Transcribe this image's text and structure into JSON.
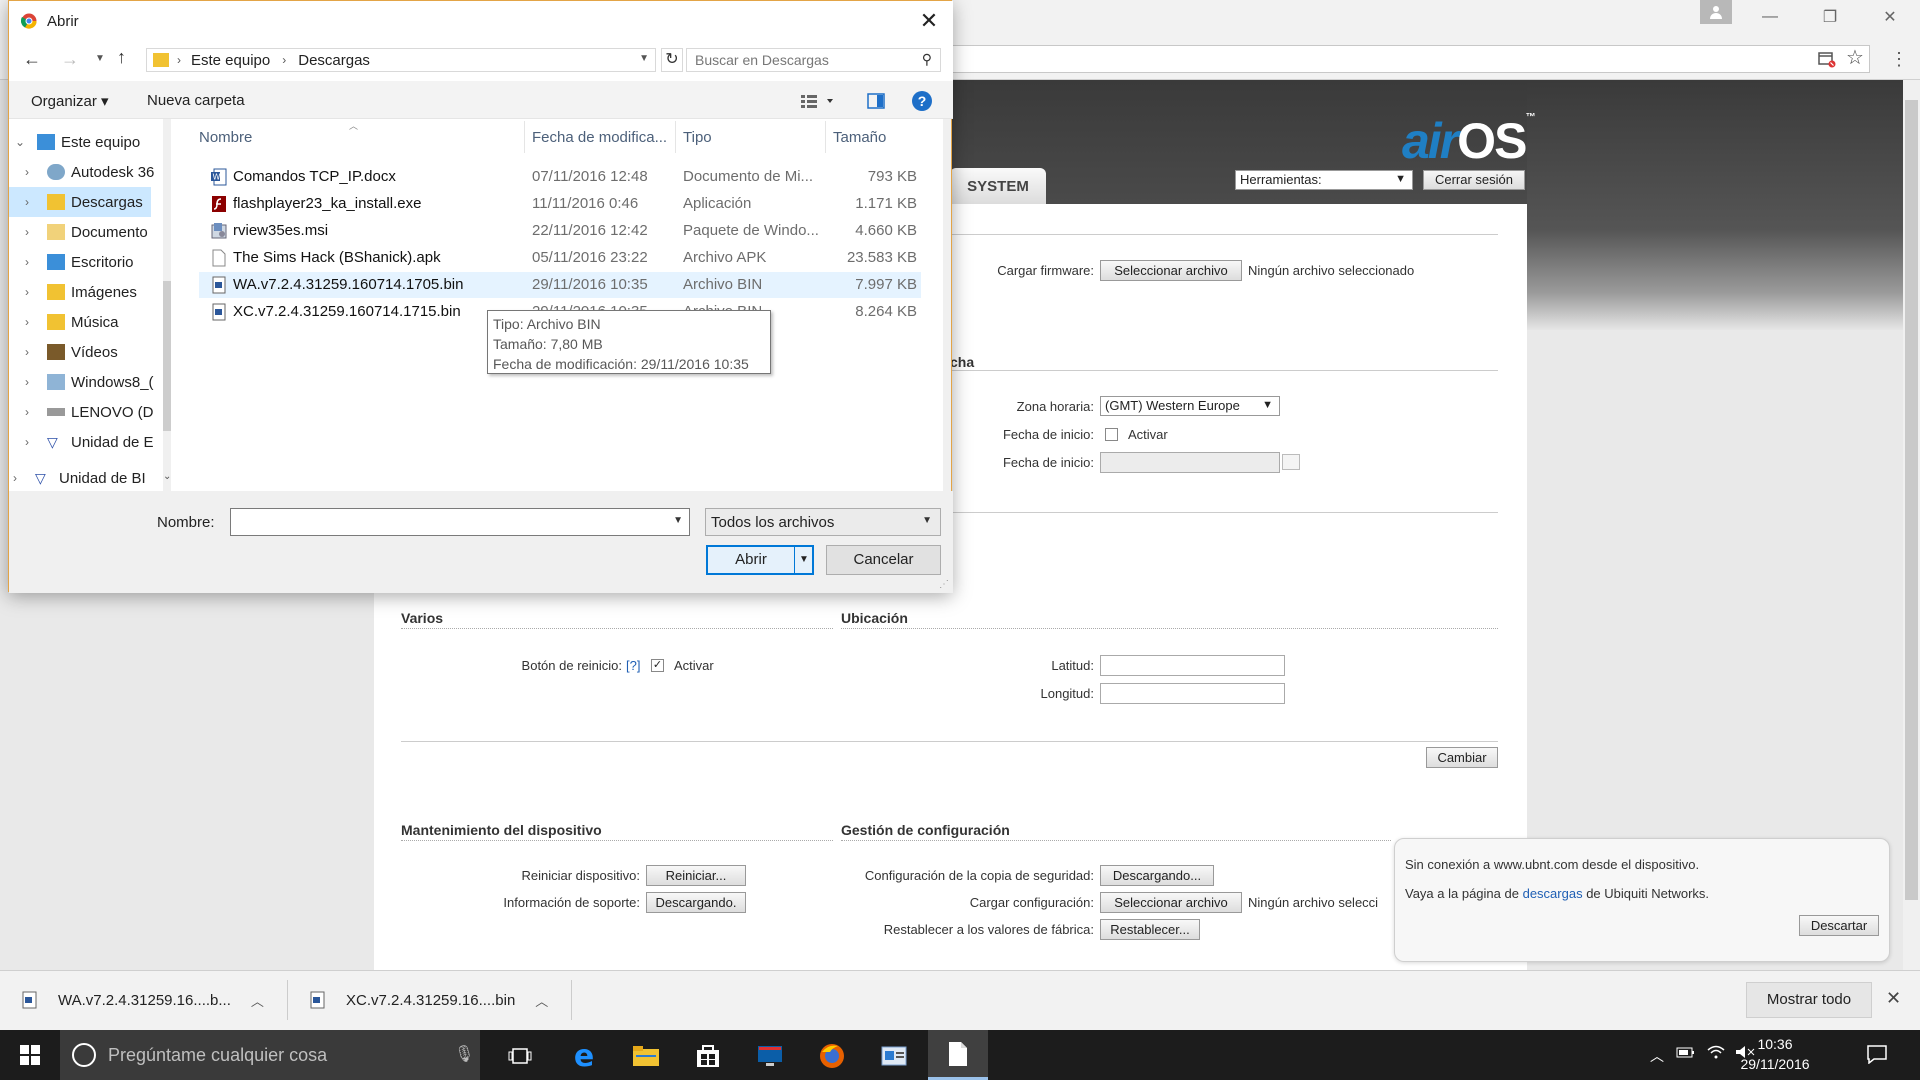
{
  "browser": {
    "user_icon": "person-icon",
    "minimize": "—",
    "restore": "❐",
    "close": "✕"
  },
  "airos": {
    "logo_air": "air",
    "logo_os": "OS",
    "logo_tm": "™",
    "tab_system": "SYSTEM",
    "tools_select": "Herramientas:",
    "logout": "Cerrar sesión",
    "firmware_label": "Cargar firmware:",
    "firmware_button": "Seleccionar archivo",
    "firmware_status": "Ningún archivo seleccionado",
    "date_section_fragment": "cha",
    "timezone_label": "Zona horaria:",
    "timezone_value": "(GMT) Western Europe",
    "start_date_label_1": "Fecha de inicio:",
    "start_date_activate": "Activar",
    "start_date_label_2": "Fecha de inicio:",
    "section_misc": "Varios",
    "section_location": "Ubicación",
    "reset_button_label": "Botón de reinicio:",
    "reset_help": "[?]",
    "reset_activate": "Activar",
    "latitude_label": "Latitud:",
    "longitude_label": "Longitud:",
    "change_button": "Cambiar",
    "section_maintenance": "Mantenimiento del dispositivo",
    "section_config": "Gestión de configuración",
    "reboot_label": "Reiniciar dispositivo:",
    "reboot_button": "Reiniciar...",
    "support_label": "Información de soporte:",
    "support_button": "Descargando.",
    "backup_label": "Configuración de la copia de seguridad:",
    "backup_button": "Descargando...",
    "upload_config_label": "Cargar configuración:",
    "upload_config_button": "Seleccionar archivo",
    "upload_config_status": "Ningún archivo selecci",
    "factory_label": "Restablecer a los valores de fábrica:",
    "factory_button": "Restablecer..."
  },
  "notice": {
    "line1": "Sin conexión a www.ubnt.com desde el dispositivo.",
    "line2_prefix": "Vaya a la página de",
    "line2_link": "descargas",
    "line2_suffix": "de Ubiquiti Networks.",
    "dismiss": "Descartar"
  },
  "downloads": {
    "items": [
      {
        "name": "WA.v7.2.4.31259.16....b..."
      },
      {
        "name": "XC.v7.2.4.31259.16....bin"
      }
    ],
    "show_all": "Mostrar todo",
    "close": "✕"
  },
  "taskbar": {
    "search_placeholder": "Pregúntame cualquier cosa",
    "time": "10:36",
    "date": "29/11/2016"
  },
  "dialog": {
    "title": "Abrir",
    "address": {
      "root": "Este equipo",
      "folder": "Descargas"
    },
    "search_placeholder": "Buscar en Descargas",
    "organize": "Organizar ▾",
    "new_folder": "Nueva carpeta",
    "help": "?",
    "nav_items": [
      {
        "label": "Este equipo",
        "icon": "computer-icon"
      },
      {
        "label": "Autodesk 36",
        "icon": "cloud-icon"
      },
      {
        "label": "Descargas",
        "icon": "download-folder-icon"
      },
      {
        "label": "Documento",
        "icon": "documents-icon"
      },
      {
        "label": "Escritorio",
        "icon": "desktop-icon"
      },
      {
        "label": "Imágenes",
        "icon": "pictures-icon"
      },
      {
        "label": "Música",
        "icon": "music-icon"
      },
      {
        "label": "Vídeos",
        "icon": "videos-icon"
      },
      {
        "label": "Windows8_(",
        "icon": "drive-icon"
      },
      {
        "label": "LENOVO (D",
        "icon": "drive-icon"
      },
      {
        "label": "Unidad de E",
        "icon": "bd-drive-icon"
      },
      {
        "label": "Unidad de BI",
        "icon": "bd-drive-icon"
      }
    ],
    "columns": {
      "name": "Nombre",
      "date": "Fecha de modifica...",
      "type": "Tipo",
      "size": "Tamaño"
    },
    "files": [
      {
        "name": "Comandos TCP_IP.docx",
        "date": "07/11/2016 12:48",
        "type": "Documento de Mi...",
        "size": "793 KB",
        "icon": "word-icon"
      },
      {
        "name": "flashplayer23_ka_install.exe",
        "date": "11/11/2016 0:46",
        "type": "Aplicación",
        "size": "1.171 KB",
        "icon": "flash-icon"
      },
      {
        "name": "rview35es.msi",
        "date": "22/11/2016 12:42",
        "type": "Paquete de Windo...",
        "size": "4.660 KB",
        "icon": "installer-icon"
      },
      {
        "name": "The Sims Hack (BShanick).apk",
        "date": "05/11/2016 23:22",
        "type": "Archivo APK",
        "size": "23.583 KB",
        "icon": "file-icon"
      },
      {
        "name": "WA.v7.2.4.31259.160714.1705.bin",
        "date": "29/11/2016 10:35",
        "type": "Archivo BIN",
        "size": "7.997 KB",
        "icon": "bin-icon"
      },
      {
        "name": "XC.v7.2.4.31259.160714.1715.bin",
        "date": "29/11/2016 10:35",
        "type": "Archivo BIN",
        "size": "8.264 KB",
        "icon": "bin-icon"
      }
    ],
    "tooltip": {
      "type": "Tipo: Archivo BIN",
      "size": "Tamaño: 7,80 MB",
      "modified": "Fecha de modificación: 29/11/2016 10:35"
    },
    "name_label": "Nombre:",
    "name_value": "",
    "filter": "Todos los archivos",
    "open_button": "Abrir",
    "cancel_button": "Cancelar"
  },
  "colors": {
    "dialog_border": "#e3a446",
    "accent_blue": "#0078d7",
    "airos_blue": "#1f7fc4",
    "selected_row": "#e5f3ff",
    "taskbar": "#1c1c1c"
  }
}
